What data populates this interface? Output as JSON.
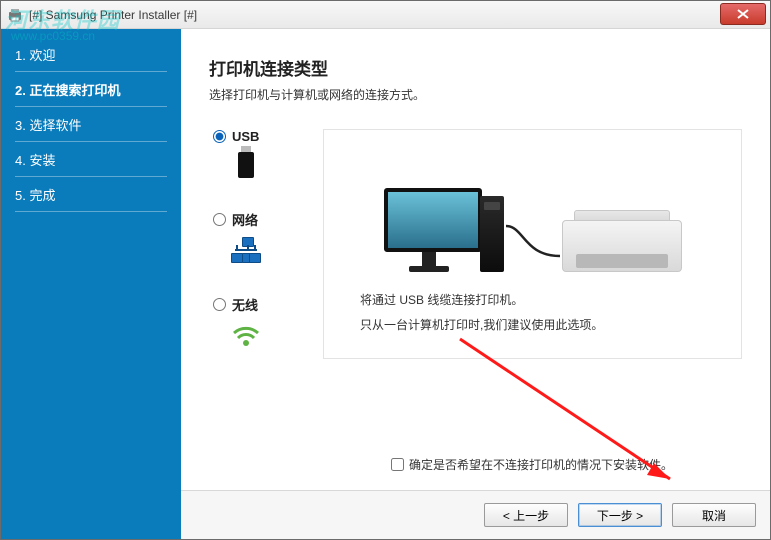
{
  "window": {
    "title": "[#] Samsung Printer Installer [#]"
  },
  "watermark": {
    "line1": "河东软件园",
    "line2": "www.pc0359.cn"
  },
  "sidebar": {
    "steps": [
      {
        "label": "1. 欢迎"
      },
      {
        "label": "2. 正在搜索打印机"
      },
      {
        "label": "3. 选择软件"
      },
      {
        "label": "4. 安装"
      },
      {
        "label": "5. 完成"
      }
    ]
  },
  "main": {
    "heading": "打印机连接类型",
    "subheading": "选择打印机与计算机或网络的连接方式。",
    "options": {
      "usb": {
        "label": "USB",
        "selected": true
      },
      "net": {
        "label": "网络",
        "selected": false
      },
      "wifi": {
        "label": "无线",
        "selected": false
      }
    },
    "illustration": {
      "line1": "将通过 USB 线缆连接打印机。",
      "line2": "只从一台计算机打印时,我们建议使用此选项。"
    },
    "checkbox": {
      "label": "确定是否希望在不连接打印机的情况下安装软件。",
      "checked": false
    }
  },
  "buttons": {
    "back": "< 上一步",
    "next": "下一步 >",
    "cancel": "取消"
  }
}
